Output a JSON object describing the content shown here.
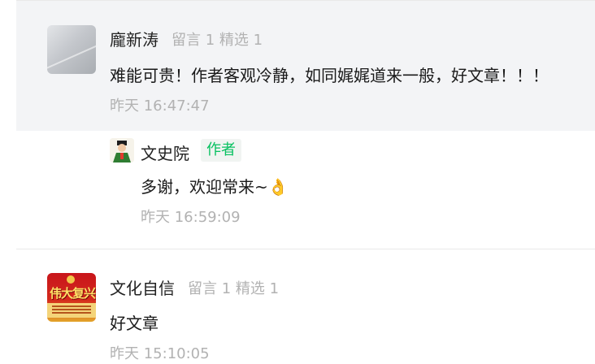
{
  "comments": [
    {
      "name": "龐新涛",
      "stats": "留言 1 精选 1",
      "text": "难能可贵！作者客观冷静，如同娓娓道来一般，好文章！！！",
      "time": "昨天 16:47:47",
      "reply": {
        "name": "文史院",
        "tag": "作者",
        "text": "多谢，欢迎常来~👌",
        "time": "昨天 16:59:09"
      }
    },
    {
      "name": "文化自信",
      "stats": "留言 1 精选 1",
      "text": "好文章",
      "time": "昨天 15:10:05",
      "avatar_text": "伟大复兴"
    }
  ]
}
